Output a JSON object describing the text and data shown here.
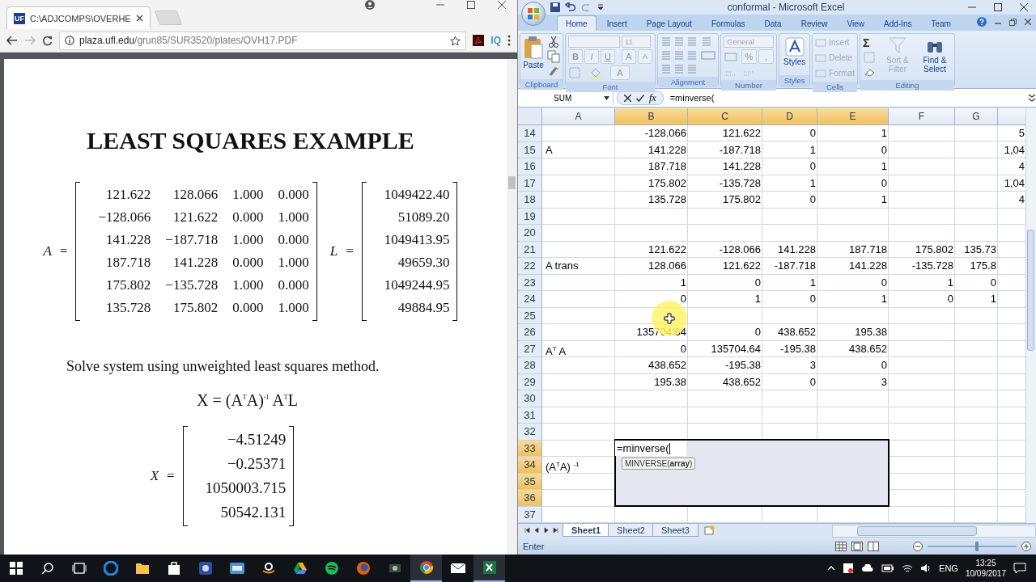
{
  "browser": {
    "tab": {
      "favicon": "UF",
      "title": "C:\\ADJCOMPS\\OVERHE"
    },
    "address": {
      "host": "plaza.ufl.edu",
      "path": "/grun85/SUR3520/plates/OVH17.PDF"
    },
    "extension_label": "IQ"
  },
  "pdf": {
    "title": "LEAST SQUARES EXAMPLE",
    "matrices": [
      {
        "label": "A",
        "equals": "=",
        "rows": [
          [
            "121.622",
            "128.066",
            "1.000",
            "0.000"
          ],
          [
            "−128.066",
            "121.622",
            "0.000",
            "1.000"
          ],
          [
            "141.228",
            "−187.718",
            "1.000",
            "0.000"
          ],
          [
            "187.718",
            "141.228",
            "0.000",
            "1.000"
          ],
          [
            "175.802",
            "−135.728",
            "1.000",
            "0.000"
          ],
          [
            "135.728",
            "175.802",
            "0.000",
            "1.000"
          ]
        ]
      },
      {
        "label": "L",
        "equals": "=",
        "rows": [
          [
            "1049422.40"
          ],
          [
            "51089.20"
          ],
          [
            "1049413.95"
          ],
          [
            "49659.30"
          ],
          [
            "1049244.95"
          ],
          [
            "49884.95"
          ]
        ]
      }
    ],
    "sentence": "Solve system using unweighted least squares method.",
    "formula": "X = (A$^{T}$A)$^{-1}$ A$^{T}$L",
    "solution": {
      "label": "X",
      "equals": "=",
      "rows": [
        [
          "−4.51249"
        ],
        [
          "−0.25371"
        ],
        [
          "1050003.715"
        ],
        [
          "50542.131"
        ]
      ]
    }
  },
  "excel": {
    "title": "conformal - Microsoft Excel",
    "ribbon_tabs": [
      {
        "label": "Home",
        "selected": true
      },
      {
        "label": "Insert",
        "selected": false
      },
      {
        "label": "Page Layout",
        "selected": false
      },
      {
        "label": "Formulas",
        "selected": false
      },
      {
        "label": "Data",
        "selected": false
      },
      {
        "label": "Review",
        "selected": false
      },
      {
        "label": "View",
        "selected": false
      },
      {
        "label": "Add-Ins",
        "selected": false
      },
      {
        "label": "Team",
        "selected": false
      }
    ],
    "groups": [
      {
        "kind": "clipboard",
        "label": "Clipboard",
        "paste": "Paste"
      },
      {
        "kind": "font",
        "label": "Font",
        "size": "11",
        "style_buttons": [
          "B",
          "I",
          "U"
        ],
        "grow_letter": "A",
        "shrink_letter": "A",
        "font_color_letter": "A"
      },
      {
        "kind": "alignment",
        "label": "Alignment"
      },
      {
        "kind": "number",
        "label": "Number",
        "format": "General",
        "percent": "%",
        "comma": ","
      },
      {
        "kind": "styles",
        "label": "Styles",
        "button": "Styles"
      },
      {
        "kind": "cells",
        "label": "Cells",
        "buttons": [
          {
            "label": "Insert",
            "disabled": true
          },
          {
            "label": "Delete",
            "disabled": true
          },
          {
            "label": "Format",
            "disabled": true
          }
        ]
      },
      {
        "kind": "editing",
        "label": "Editing",
        "sum": "Σ",
        "buttons": [
          {
            "label": "Sort & Filter",
            "disabled": true
          },
          {
            "label": "Find & Select",
            "disabled": false
          }
        ]
      }
    ],
    "name_box": "SUM",
    "function_label": "fx",
    "formula": "=minverse(",
    "columns": [
      {
        "label": "A",
        "selected": false
      },
      {
        "label": "B",
        "selected": true
      },
      {
        "label": "C",
        "selected": true
      },
      {
        "label": "D",
        "selected": true
      },
      {
        "label": "E",
        "selected": true
      },
      {
        "label": "F",
        "selected": false
      },
      {
        "label": "G",
        "selected": false
      }
    ],
    "rows": [
      {
        "number": "14",
        "selected": false,
        "cells": [
          null,
          "-128.066",
          "121.622",
          "0",
          "1",
          null,
          null,
          "5"
        ]
      },
      {
        "number": "15",
        "selected": false,
        "cells": [
          "A",
          "141.228",
          "-187.718",
          "1",
          "0",
          null,
          null,
          "1,04"
        ]
      },
      {
        "number": "16",
        "selected": false,
        "cells": [
          null,
          "187.718",
          "141.228",
          "0",
          "1",
          null,
          null,
          "4"
        ]
      },
      {
        "number": "17",
        "selected": false,
        "cells": [
          null,
          "175.802",
          "-135.728",
          "1",
          "0",
          null,
          null,
          "1,04"
        ]
      },
      {
        "number": "18",
        "selected": false,
        "cells": [
          null,
          "135.728",
          "175.802",
          "0",
          "1",
          null,
          null,
          "4"
        ]
      },
      {
        "number": "19",
        "selected": false
      },
      {
        "number": "20",
        "selected": false
      },
      {
        "number": "21",
        "selected": false,
        "cells": [
          null,
          "121.622",
          "-128.066",
          "141.228",
          "187.718",
          "175.802",
          "135.73"
        ]
      },
      {
        "number": "22",
        "selected": false,
        "cells": [
          "A trans",
          "128.066",
          "121.622",
          "-187.718",
          "141.228",
          "-135.728",
          "175.8"
        ]
      },
      {
        "number": "23",
        "selected": false,
        "cells": [
          null,
          "1",
          "0",
          "1",
          "0",
          "1",
          "0"
        ]
      },
      {
        "number": "24",
        "selected": false,
        "cells": [
          null,
          "0",
          "1",
          "0",
          "1",
          "0",
          "1"
        ]
      },
      {
        "number": "25",
        "selected": false
      },
      {
        "number": "26",
        "selected": false,
        "cells": [
          null,
          "135704.64",
          "0",
          "438.652",
          "195.38"
        ]
      },
      {
        "number": "27",
        "selected": false,
        "cells": [
          "A$^{T}$ A",
          "0",
          "135704.64",
          "-195.38",
          "438.652"
        ]
      },
      {
        "number": "28",
        "selected": false,
        "cells": [
          null,
          "438.652",
          "-195.38",
          "3",
          "0"
        ]
      },
      {
        "number": "29",
        "selected": false,
        "cells": [
          null,
          "195.38",
          "438.652",
          "0",
          "3"
        ]
      },
      {
        "number": "30",
        "selected": false
      },
      {
        "number": "31",
        "selected": false
      },
      {
        "number": "32",
        "selected": false
      },
      {
        "number": "33",
        "selected": true,
        "cells": [
          null,
          {
            "kind": "edit",
            "text": "=minverse(",
            "tooltip": "MINVERSE(**array**)"
          }
        ]
      },
      {
        "number": "34",
        "selected": true,
        "cells": [
          "(A$^{T}$A) $^{-1}$"
        ]
      },
      {
        "number": "35",
        "selected": true
      },
      {
        "number": "36",
        "selected": true
      },
      {
        "number": "37",
        "selected": false
      }
    ],
    "sheets": [
      {
        "label": "Sheet1",
        "selected": true
      },
      {
        "label": "Sheet2",
        "selected": false
      },
      {
        "label": "Sheet3",
        "selected": false
      }
    ],
    "status": "Enter",
    "zoom": {
      "level": 0.55
    }
  },
  "taskbar": {
    "apps": [
      {
        "kind": "edge",
        "active": false
      },
      {
        "kind": "explorer",
        "active": false
      },
      {
        "kind": "store",
        "active": false
      },
      {
        "kind": "app",
        "active": false
      },
      {
        "kind": "window",
        "active": false
      },
      {
        "kind": "amazon",
        "active": false
      },
      {
        "kind": "drive",
        "active": false
      },
      {
        "kind": "spotify",
        "active": false
      },
      {
        "kind": "firefox",
        "active": false
      },
      {
        "kind": "tool",
        "active": false
      },
      {
        "kind": "chrome",
        "active": true
      },
      {
        "kind": "mail",
        "active": false
      },
      {
        "kind": "excel",
        "active": true
      }
    ],
    "language": "ENG",
    "time": "13:25",
    "date": "10/09/2017"
  }
}
